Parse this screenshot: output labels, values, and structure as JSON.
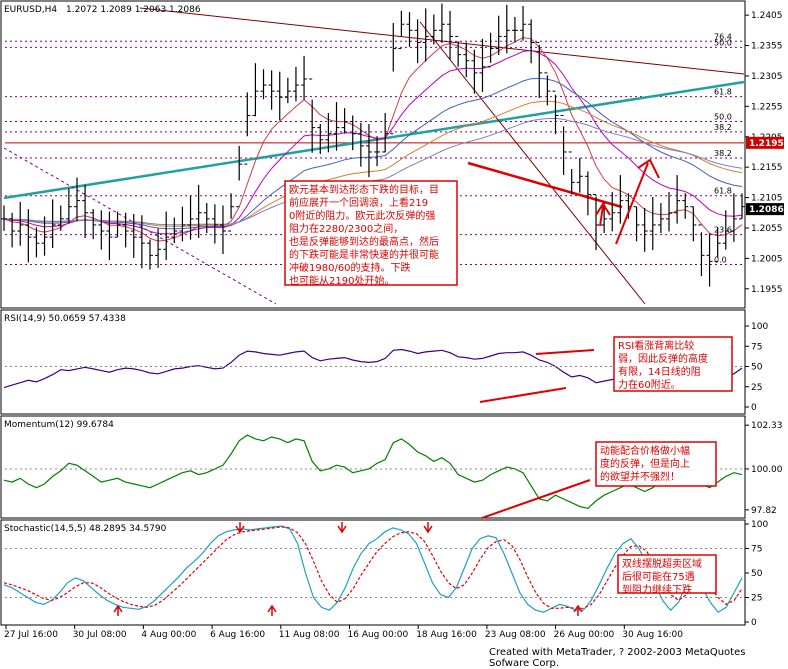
{
  "footer": "Created with MetaTrader, ? 2002-2003 MetaQuotes Sofware Corp.",
  "chart_data": [
    {
      "type": "line",
      "title": "EURUSD,H4",
      "ohlc": "1.2072 1.2089 1.2063 1.2086",
      "ylim": [
        1.193,
        1.242
      ],
      "ticks": [
        "1.2405",
        "1.2355",
        "1.2305",
        "1.2255",
        "1.2205",
        "1.2155",
        "1.2105",
        "1.2055",
        "1.2005",
        "1.1955"
      ],
      "last_price": "1.2086",
      "mark_price": "1.2195",
      "fib_levels": [
        {
          "label": "76.4",
          "value": 1.2362
        },
        {
          "label": "50.0",
          "value": 1.2352
        },
        {
          "label": "61.8",
          "value": 1.2271
        },
        {
          "label": "50.0",
          "value": 1.223
        },
        {
          "label": "38.2",
          "value": 1.2213
        },
        {
          "label": "38.2",
          "value": 1.217
        },
        {
          "label": "61.8",
          "value": 1.2108
        },
        {
          "label": "23.6",
          "value": 1.2044
        },
        {
          "label": "0.0",
          "value": 1.1995
        }
      ],
      "price": [
        1.207,
        1.205,
        1.206,
        1.204,
        1.203,
        1.204,
        1.206,
        1.207,
        1.209,
        1.21,
        1.208,
        1.206,
        1.205,
        1.204,
        1.206,
        1.205,
        1.204,
        1.203,
        1.201,
        1.202,
        1.204,
        1.205,
        1.206,
        1.207,
        1.208,
        1.207,
        1.206,
        1.205,
        1.209,
        1.216,
        1.224,
        1.228,
        1.229,
        1.228,
        1.227,
        1.228,
        1.229,
        1.23,
        1.222,
        1.22,
        1.221,
        1.222,
        1.223,
        1.221,
        1.219,
        1.218,
        1.218,
        1.221,
        1.235,
        1.239,
        1.238,
        1.236,
        1.237,
        1.238,
        1.239,
        1.237,
        1.234,
        1.233,
        1.231,
        1.232,
        1.235,
        1.237,
        1.238,
        1.238,
        1.239,
        1.236,
        1.231,
        1.228,
        1.224,
        1.218,
        1.213,
        1.214,
        1.211,
        1.206,
        1.207,
        1.208,
        1.21,
        1.209,
        1.206,
        1.205,
        1.206,
        1.207,
        1.208,
        1.21,
        1.209,
        1.206,
        1.201,
        1.2,
        1.203,
        1.205,
        1.207,
        1.209
      ],
      "annotation": "欧元基本到达形态下跌的目标，目前应展开一个回调浪，上看2190附近的阻力。欧元此次反弹的强阻力在2280/2300之间，也是反弹能够到达的最高点，然后的下跌可能是非常快速的并很可能冲破1980/60的支持。下跌也可能从2190处开始。"
    },
    {
      "type": "line",
      "title": "RSI(14,9) 50.0659 57.4338",
      "ticks": [
        "100",
        "75",
        "50",
        "25",
        "0"
      ],
      "ylim": [
        0,
        100
      ],
      "series": [
        {
          "values": [
            24,
            27,
            30,
            33,
            31,
            35,
            40,
            46,
            45,
            47,
            49,
            47,
            45,
            43,
            46,
            48,
            47,
            45,
            42,
            41,
            44,
            47,
            48,
            50,
            51,
            49,
            47,
            48,
            55,
            64,
            69,
            68,
            66,
            65,
            64,
            66,
            68,
            69,
            61,
            57,
            59,
            60,
            61,
            58,
            56,
            55,
            56,
            60,
            70,
            71,
            69,
            66,
            68,
            69,
            70,
            67,
            62,
            61,
            59,
            60,
            63,
            66,
            67,
            67,
            68,
            64,
            58,
            55,
            50,
            43,
            37,
            39,
            36,
            30,
            32,
            34,
            37,
            36,
            33,
            32,
            34,
            36,
            38,
            41,
            40,
            35,
            28,
            27,
            33,
            37,
            41,
            48
          ]
        }
      ],
      "annotation": "RSI看涨背离比较弱，因此反弹的高度有限，14日线的阻力在60附近。"
    },
    {
      "type": "line",
      "title": "Momentum(12) 99.6784",
      "ticks": [
        "102.33",
        "100.00",
        "97.82"
      ],
      "ylim": [
        97.6,
        102.5
      ],
      "series": [
        {
          "values": [
            99.4,
            99.3,
            99.5,
            99.2,
            99.0,
            99.2,
            99.6,
            99.9,
            100.3,
            100.2,
            99.9,
            99.6,
            99.3,
            99.4,
            99.5,
            99.3,
            99.2,
            99.1,
            99.0,
            99.2,
            99.4,
            99.6,
            99.8,
            99.9,
            99.7,
            99.8,
            100.0,
            100.2,
            100.8,
            101.5,
            101.8,
            101.6,
            101.5,
            101.7,
            101.6,
            101.4,
            101.6,
            101.5,
            100.4,
            99.9,
            100.0,
            100.2,
            100.1,
            99.8,
            99.9,
            100.0,
            100.3,
            100.5,
            101.4,
            101.6,
            101.3,
            100.9,
            100.7,
            100.4,
            100.6,
            100.3,
            99.7,
            99.5,
            99.3,
            99.4,
            99.7,
            99.9,
            100.1,
            100.0,
            99.8,
            99.1,
            98.4,
            98.3,
            98.6,
            98.4,
            98.2,
            98.0,
            97.9,
            98.3,
            98.6,
            98.8,
            99.0,
            99.2,
            99.0,
            98.8,
            99.0,
            99.3,
            99.6,
            99.9,
            100.1,
            99.7,
            99.2,
            99.0,
            99.3,
            99.6,
            99.8,
            99.7
          ]
        }
      ],
      "annotation": "动能配合价格做小幅度的反弹，但是向上的欲望并不强烈！"
    },
    {
      "type": "line",
      "title": "Stochastic(14,5,5) 48.2895 34.5790",
      "ticks": [
        "100",
        "75",
        "50",
        "25",
        "0"
      ],
      "ylim": [
        0,
        100
      ],
      "series": [
        {
          "values": [
            38,
            35,
            30,
            25,
            20,
            18,
            22,
            30,
            40,
            45,
            42,
            35,
            28,
            22,
            18,
            15,
            14,
            13,
            16,
            22,
            30,
            38,
            46,
            55,
            62,
            70,
            80,
            88,
            92,
            94,
            95,
            94,
            95,
            96,
            97,
            98,
            95,
            80,
            50,
            25,
            15,
            12,
            20,
            35,
            55,
            70,
            80,
            85,
            92,
            96,
            94,
            90,
            80,
            60,
            40,
            28,
            25,
            35,
            55,
            75,
            85,
            88,
            86,
            70,
            50,
            30,
            18,
            12,
            10,
            14,
            18,
            16,
            12,
            12,
            22,
            38,
            55,
            70,
            80,
            85,
            75,
            60,
            40,
            22,
            12,
            20,
            40,
            48,
            35,
            20,
            10,
            15,
            30,
            45
          ]
        },
        {
          "values": [
            40,
            38,
            35,
            32,
            28,
            24,
            22,
            25,
            30,
            36,
            40,
            40,
            36,
            30,
            25,
            21,
            18,
            16,
            15,
            17,
            22,
            29,
            36,
            44,
            52,
            60,
            68,
            76,
            84,
            89,
            92,
            93,
            94,
            95,
            96,
            97,
            96,
            91,
            80,
            62,
            42,
            28,
            20,
            24,
            34,
            48,
            60,
            72,
            80,
            87,
            91,
            92,
            90,
            82,
            68,
            52,
            40,
            34,
            38,
            50,
            64,
            76,
            82,
            84,
            78,
            64,
            46,
            30,
            19,
            14,
            14,
            15,
            14,
            14,
            18,
            28,
            42,
            56,
            68,
            77,
            78,
            72,
            58,
            42,
            28,
            22,
            28,
            36,
            40,
            35,
            25,
            18,
            22,
            34
          ]
        }
      ],
      "annotation": "双线摆脱超卖区域后很可能在75遇到阻力继续下跌"
    }
  ],
  "x_labels": [
    "27 Jul 16:00",
    "30 Jul 08:00",
    "4 Aug 00:00",
    "6 Aug 16:00",
    "11 Aug 08:00",
    "16 Aug 00:00",
    "18 Aug 16:00",
    "23 Aug 08:00",
    "26 Aug 00:00",
    "30 Aug 16:00"
  ]
}
